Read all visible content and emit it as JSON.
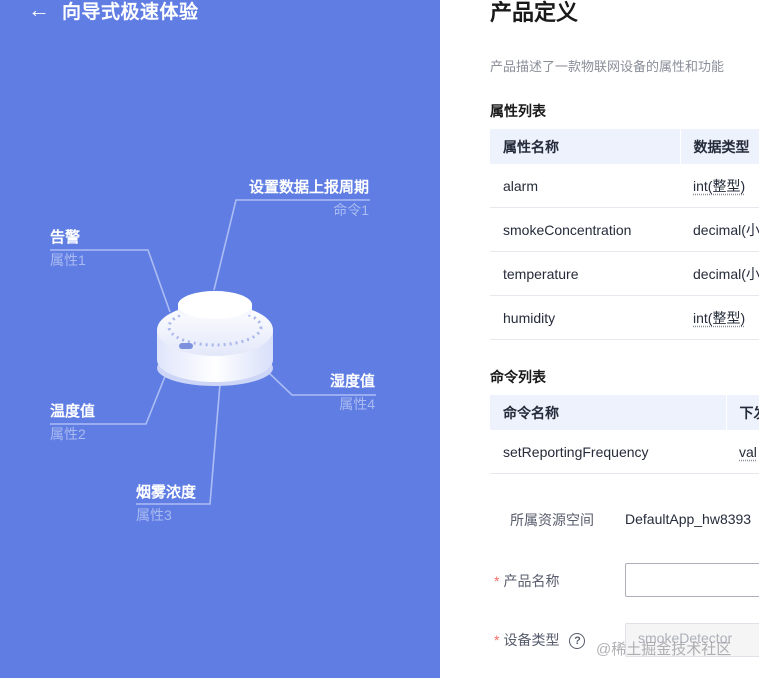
{
  "left_panel": {
    "back_label": "向导式极速体验",
    "diagram": {
      "command": {
        "name": "设置数据上报周期",
        "kind": "命令1"
      },
      "prop1": {
        "name": "告警",
        "kind": "属性1"
      },
      "prop2": {
        "name": "温度值",
        "kind": "属性2"
      },
      "prop3": {
        "name": "烟雾浓度",
        "kind": "属性3"
      },
      "prop4": {
        "name": "湿度值",
        "kind": "属性4"
      }
    },
    "colors": {
      "background": "#5f7de3",
      "line": "#b5c4f5"
    }
  },
  "right_panel": {
    "title": "产品定义",
    "description": "产品描述了一款物联网设备的属性和功能",
    "properties_title": "属性列表",
    "properties_headers": [
      "属性名称",
      "数据类型"
    ],
    "properties_rows": [
      [
        "alarm",
        "int(整型)"
      ],
      [
        "smokeConcentration",
        "decimal(小"
      ],
      [
        "temperature",
        "decimal(小"
      ],
      [
        "humidity",
        "int(整型)"
      ]
    ],
    "commands_title": "命令列表",
    "commands_headers": [
      "命令名称",
      "下发"
    ],
    "commands_rows": [
      [
        "setReportingFrequency",
        "val"
      ]
    ],
    "form": {
      "resource_space_label": "所属资源空间",
      "resource_space_value": "DefaultApp_hw8393",
      "product_name_label": "产品名称",
      "product_name_value": "",
      "device_type_label": "设备类型",
      "device_type_value": "smokeDetector",
      "required_mark": "*",
      "help_icon": "?"
    }
  },
  "watermark": "@稀土掘金技术社区"
}
